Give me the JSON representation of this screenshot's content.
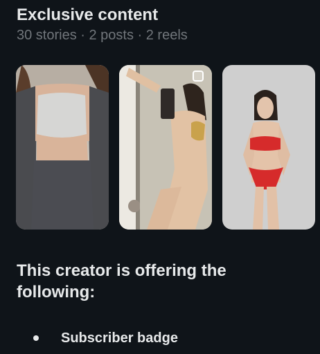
{
  "section": {
    "title": "Exclusive content",
    "subtitle": "30 stories · 2 posts · 2 reels"
  },
  "thumbnails": [
    {
      "icon": "photo-thumbnail"
    },
    {
      "icon": "reel-icon"
    },
    {
      "icon": "photo-thumbnail"
    }
  ],
  "offer": {
    "heading": "This creator is offering the following:",
    "items": [
      {
        "label": "Subscriber badge"
      }
    ]
  },
  "colors": {
    "background": "#0f1419",
    "primary_text": "#e7e9ea",
    "secondary_text": "#71767b"
  }
}
